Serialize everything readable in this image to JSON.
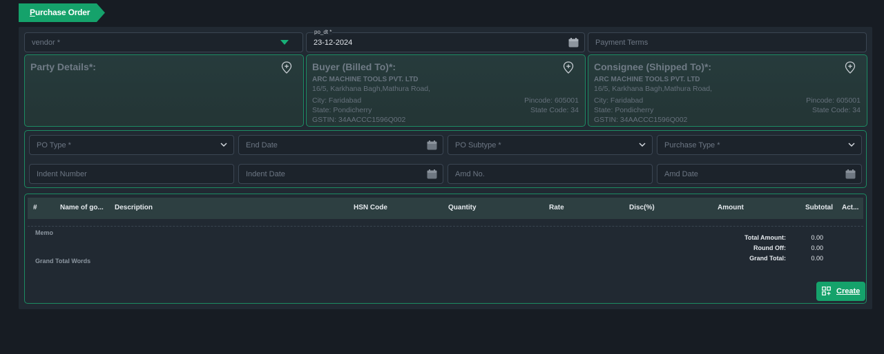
{
  "tab": {
    "title_first": "P",
    "title_rest": "urchase Order"
  },
  "header_fields": {
    "vendor": {
      "placeholder": "vendor *"
    },
    "po_dt": {
      "label": "po_dt *",
      "value": "23-12-2024"
    },
    "payment_terms": {
      "placeholder": "Payment Terms"
    }
  },
  "party": {
    "title": "Party Details*:"
  },
  "buyer": {
    "title": "Buyer (Billed To)*:",
    "company": "ARC MACHINE TOOLS PVT. LTD",
    "address": "16/5, Karkhana Bagh,Mathura Road,",
    "city": "City: Faridabad",
    "state": "State: Pondicherry",
    "gstin": "GSTIN: 34AACCC1596Q002",
    "pincode": "Pincode: 605001",
    "state_code": "State Code: 34"
  },
  "consignee": {
    "title": "Consignee (Shipped To)*:",
    "company": "ARC MACHINE TOOLS PVT. LTD",
    "address": "16/5, Karkhana Bagh,Mathura Road,",
    "city": "City: Faridabad",
    "state": "State: Pondicherry",
    "gstin": "GSTIN: 34AACCC1596Q002",
    "pincode": "Pincode: 605001",
    "state_code": "State Code: 34"
  },
  "po_fields": {
    "po_type": "PO Type *",
    "end_date": "End Date",
    "po_subtype": "PO Subtype *",
    "purchase_type": "Purchase Type *",
    "indent_number": "Indent Number",
    "indent_date": "Indent Date",
    "amd_no": "Amd No.",
    "amd_date": "Amd Date"
  },
  "table": {
    "columns": [
      "#",
      "Name of go...",
      "Description",
      "HSN Code",
      "Quantity",
      "Rate",
      "Disc(%)",
      "Amount",
      "Subtotal",
      "Act..."
    ]
  },
  "footer": {
    "memo": "Memo",
    "grand_total_words": "Grand Total Words",
    "total_amount_label": "Total Amount:",
    "total_amount": "0.00",
    "round_off_label": "Round Off:",
    "round_off": "0.00",
    "grand_total_label": "Grand Total:",
    "grand_total": "0.00"
  },
  "actions": {
    "create_first": "C",
    "create_rest": "reate"
  },
  "colors": {
    "accent": "#15a26b",
    "background": "#171c23",
    "panel": "#212932",
    "border_green": "#1c8c63"
  },
  "icons": [
    "chevron-down-icon",
    "calendar-icon",
    "location-add-icon",
    "create-qr-icon",
    "dropdown-triangle-icon"
  ]
}
